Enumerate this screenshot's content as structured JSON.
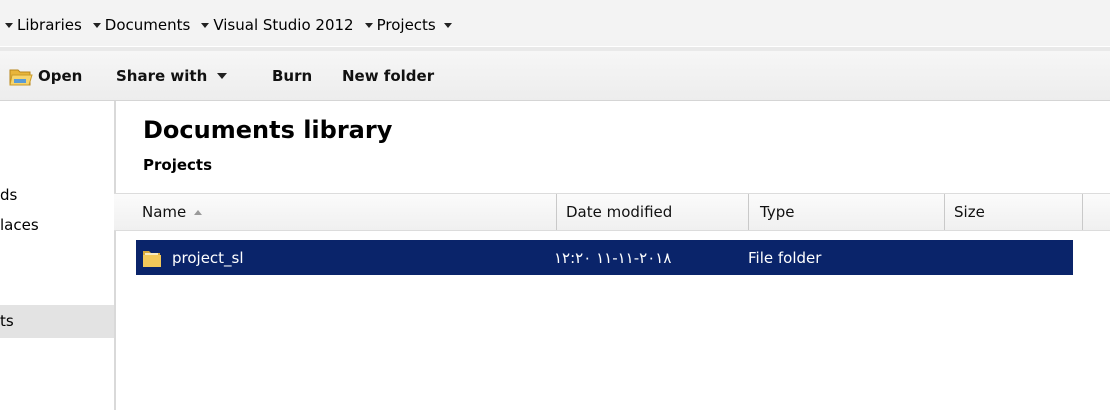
{
  "breadcrumb": [
    "Libraries",
    "Documents",
    "Visual Studio 2012",
    "Projects"
  ],
  "toolbar": {
    "open_label": "Open",
    "share_label": "Share with",
    "burn_label": "Burn",
    "new_folder_label": "New folder"
  },
  "nav": {
    "item1": "ds",
    "item2": "laces",
    "item3_selected": "ts"
  },
  "library": {
    "title": "Documents library",
    "subtitle": "Projects"
  },
  "columns": {
    "name": "Name",
    "date": "Date modified",
    "type": "Type",
    "size": "Size"
  },
  "files": [
    {
      "name": "project_sl",
      "date": "٢٠١٨-١١-١١ ١٢:٢٠",
      "type": "File folder",
      "size": ""
    }
  ],
  "colors": {
    "selection": "#0a246a",
    "toolbar_bg": "#f0f0f0"
  }
}
